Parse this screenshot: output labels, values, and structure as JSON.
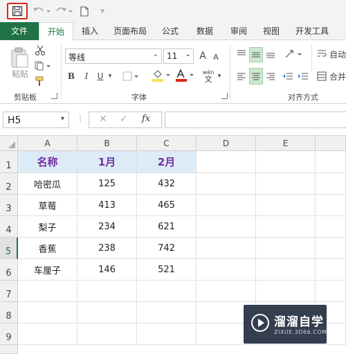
{
  "qat": {
    "customize": "▿"
  },
  "tabs": [
    {
      "label": "文件"
    },
    {
      "label": "开始"
    },
    {
      "label": "插入"
    },
    {
      "label": "页面布局"
    },
    {
      "label": "公式"
    },
    {
      "label": "数据"
    },
    {
      "label": "审阅"
    },
    {
      "label": "视图"
    },
    {
      "label": "开发工具"
    }
  ],
  "ribbon": {
    "paste_label": "粘贴",
    "clipboard_label": "剪贴板",
    "font_group_label": "字体",
    "align_group_label": "对齐方式",
    "font_name": "等线",
    "font_size": "11",
    "bold": "B",
    "italic": "I",
    "underline": "U",
    "grow": "A",
    "shrink": "A",
    "font_color": "A",
    "phonetic_top": "wén",
    "phonetic_bottom": "文",
    "wrap_label": "自动",
    "merge_label": "合并",
    "highlight_color": "#f3e35a",
    "font_color_bar": "#d9261c"
  },
  "formula_bar": {
    "name_box": "H5",
    "fx": "fx",
    "value": ""
  },
  "grid": {
    "columns": [
      "A",
      "B",
      "C",
      "D",
      "E",
      ""
    ],
    "rows": [
      "1",
      "2",
      "3",
      "4",
      "5",
      "6",
      "7",
      "8",
      "9"
    ],
    "selected_row": "5",
    "headers": [
      "名称",
      "1月",
      "2月"
    ],
    "data": [
      [
        "哈密瓜",
        "125",
        "432"
      ],
      [
        "草莓",
        "413",
        "465"
      ],
      [
        "梨子",
        "234",
        "621"
      ],
      [
        "香蕉",
        "238",
        "742"
      ],
      [
        "车厘子",
        "146",
        "521"
      ]
    ],
    "header_fill": "#ddebf7",
    "header_text_color": "#7030a0"
  },
  "watermark": {
    "title": "溜溜自学",
    "subtitle": "ZIXUE.3D66.COM"
  },
  "colors": {
    "excel_green": "#217346",
    "save_highlight": "#d9261c"
  }
}
